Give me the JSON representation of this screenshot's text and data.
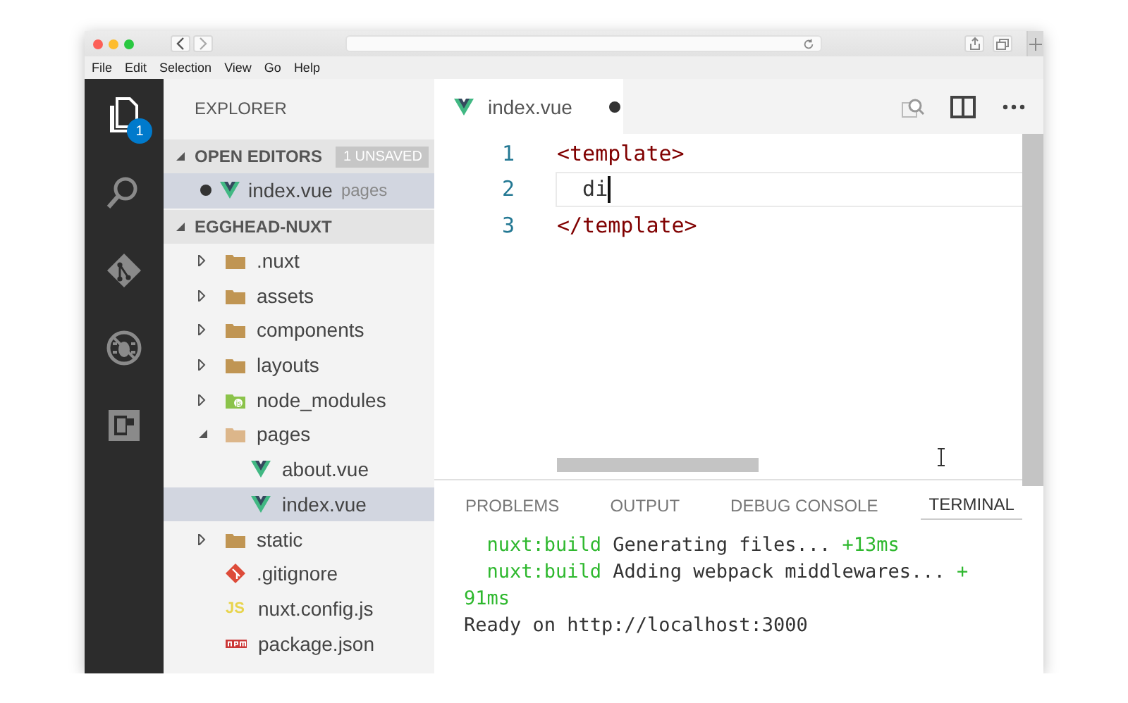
{
  "menu": [
    "File",
    "Edit",
    "Selection",
    "View",
    "Go",
    "Help"
  ],
  "activity_bar": [
    {
      "kind": "files",
      "selected": true,
      "badge": "1"
    },
    {
      "kind": "search",
      "selected": false
    },
    {
      "kind": "git",
      "selected": false
    },
    {
      "kind": "debug",
      "selected": false
    },
    {
      "kind": "extensions",
      "selected": false
    }
  ],
  "sidebar": {
    "title": "EXPLORER",
    "open_editors": {
      "label": "OPEN EDITORS",
      "expanded": true,
      "badge": "1 UNSAVED",
      "items": [
        {
          "name": "index.vue",
          "folder": "pages",
          "kind": "vue",
          "unsaved": true,
          "selected": true
        }
      ]
    },
    "project": {
      "label": "EGGHEAD-NUXT",
      "expanded": true,
      "items": [
        {
          "name": ".nuxt",
          "kind": "folder",
          "expanded": false,
          "selected": false
        },
        {
          "name": "assets",
          "kind": "folder",
          "expanded": false,
          "selected": false
        },
        {
          "name": "components",
          "kind": "folder",
          "expanded": false,
          "selected": false
        },
        {
          "name": "layouts",
          "kind": "folder",
          "expanded": false,
          "selected": false
        },
        {
          "name": "node_modules",
          "kind": "node",
          "expanded": false,
          "selected": false
        },
        {
          "name": "pages",
          "kind": "folder",
          "expanded": true,
          "selected": false,
          "children": [
            {
              "name": "about.vue",
              "kind": "vue",
              "selected": false
            },
            {
              "name": "index.vue",
              "kind": "vue",
              "selected": true
            }
          ]
        },
        {
          "name": "static",
          "kind": "folder",
          "expanded": false,
          "selected": false
        },
        {
          "name": ".gitignore",
          "kind": "git",
          "selected": false
        },
        {
          "name": "nuxt.config.js",
          "kind": "js",
          "icon_label": "JS",
          "selected": false
        },
        {
          "name": "package.json",
          "kind": "npm",
          "selected": false
        }
      ]
    }
  },
  "editor": {
    "tab": {
      "name": "index.vue",
      "kind": "vue",
      "unsaved": true,
      "selected": true
    },
    "lines": [
      {
        "number": "1",
        "text": "<template>",
        "kind": "tag",
        "current": false
      },
      {
        "number": "2",
        "text": "  di",
        "kind": "plain",
        "current": true
      },
      {
        "number": "3",
        "text": "</template>",
        "kind": "tag",
        "current": false
      }
    ]
  },
  "panel": {
    "tabs": [
      {
        "label": "PROBLEMS",
        "selected": false
      },
      {
        "label": "OUTPUT",
        "selected": false
      },
      {
        "label": "DEBUG CONSOLE",
        "selected": false
      },
      {
        "label": "TERMINAL",
        "selected": true
      }
    ],
    "terminal": [
      [
        {
          "text": "  nuxt:build",
          "kind": "accent"
        },
        {
          "text": " Generating files... ",
          "kind": "plain"
        },
        {
          "text": "+13ms",
          "kind": "accent"
        }
      ],
      [
        {
          "text": "  nuxt:build",
          "kind": "accent"
        },
        {
          "text": " Adding webpack middlewares... ",
          "kind": "plain"
        },
        {
          "text": "+",
          "kind": "accent"
        }
      ],
      [
        {
          "text": "91ms",
          "kind": "accent"
        }
      ],
      [
        {
          "text": "Ready on http://localhost:3000",
          "kind": "plain"
        }
      ]
    ]
  }
}
